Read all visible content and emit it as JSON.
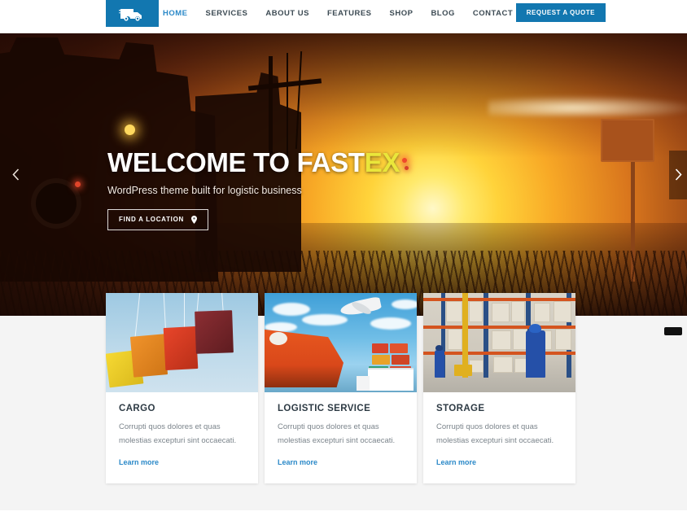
{
  "header": {
    "logo_icon": "delivery-truck-icon",
    "brand_color": "#1277b0",
    "nav": [
      {
        "label": "HOME",
        "active": true
      },
      {
        "label": "SERVICES",
        "active": false
      },
      {
        "label": "ABOUT US",
        "active": false
      },
      {
        "label": "FEATURES",
        "active": false
      },
      {
        "label": "SHOP",
        "active": false
      },
      {
        "label": "BLOG",
        "active": false
      },
      {
        "label": "CONTACT",
        "active": false
      }
    ],
    "quote_button": "REQUEST A QUOTE",
    "active_color": "#2b89c8"
  },
  "hero": {
    "title_main": "WELCOME TO FAST",
    "title_accent": "EX",
    "accent_color": "#eae63a",
    "subtitle": "WordPress theme built for logistic business",
    "cta_label": "FIND A LOCATION",
    "cta_icon": "map-pin-icon",
    "prev_icon": "chevron-left-icon",
    "next_icon": "chevron-right-icon",
    "background": "sunset-truck-silhouette"
  },
  "services": {
    "cards": [
      {
        "title": "CARGO",
        "description": "Corrupti quos dolores et quas molestias excepturi sint occaecati.",
        "link": "Learn more",
        "image": "shipping-containers-crane-image"
      },
      {
        "title": "LOGISTIC SERVICE",
        "description": "Corrupti quos dolores et quas molestias excepturi sint occaecati.",
        "link": "Learn more",
        "image": "cargo-ship-plane-truck-image"
      },
      {
        "title": "STORAGE",
        "description": "Corrupti quos dolores et quas molestias excepturi sint occaecati.",
        "link": "Learn more",
        "image": "warehouse-workers-image"
      }
    ],
    "link_color": "#2b89c8"
  },
  "widgets": {
    "floating_chip": ""
  }
}
